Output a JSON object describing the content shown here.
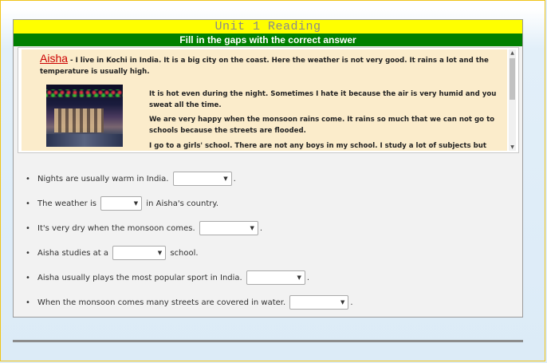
{
  "header": {
    "title": "Unit 1 Reading",
    "subtitle": "Fill in the gaps with the correct answer"
  },
  "reading": {
    "name": "Aisha",
    "intro": " - I live in Kochi in India. It is a big city on the coast. Here the weather is not very good. It rains a lot and the temperature is usually high.",
    "paragraphs": [
      "It is hot even during the night. Sometimes I hate it because the air is very humid and you sweat all the time.",
      "We are very happy when the monsoon rains come. It rains so much that we can not go to schools because the streets are flooded.",
      "I go to a girls' school. There are not any boys in my school.  I study a lot of subjects but my favourite one"
    ]
  },
  "questions": [
    {
      "before": "Nights are usually warm in India.",
      "after": ".",
      "selected": ""
    },
    {
      "before": "The weather is",
      "after": "in Aisha's country.",
      "selected": ""
    },
    {
      "before": "It's very dry when the monsoon comes.",
      "after": ".",
      "selected": ""
    },
    {
      "before": "Aisha studies at a",
      "after": "school.",
      "selected": ""
    },
    {
      "before": "Aisha usually plays the most popular sport in India.",
      "after": ".",
      "selected": ""
    },
    {
      "before": "When the monsoon comes many streets are covered in water.",
      "after": ".",
      "selected": ""
    }
  ],
  "icons": {
    "bullet": "•",
    "dropdown_arrow": "▼",
    "scroll_up": "▲",
    "scroll_down": "▼"
  }
}
